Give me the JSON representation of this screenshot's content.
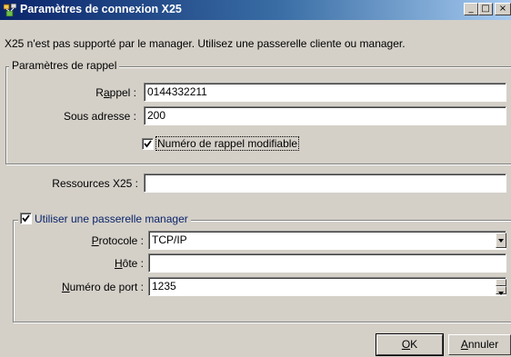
{
  "window": {
    "title": "Paramètres de connexion X25",
    "minimize_glyph": "_",
    "maximize_glyph": "□",
    "close_glyph": "×"
  },
  "info_text": "X25 n'est pas supporté par le manager. Utilisez une passerelle cliente ou manager.",
  "callback_group": {
    "legend": "Paramètres de rappel",
    "rappel_label_pre": "R",
    "rappel_label_u": "a",
    "rappel_label_post": "ppel :",
    "rappel_value": "0144332211",
    "sous_adresse_label": "Sous adresse :",
    "sous_adresse_value": "200",
    "modifiable_checked": true,
    "modifiable_label": "Numéro de rappel modifiable"
  },
  "ressources": {
    "label": "Ressources X25 :",
    "value": ""
  },
  "gateway_group": {
    "checked": true,
    "legend": "Utiliser une passerelle manager",
    "protocole_label_u": "P",
    "protocole_label_rest": "rotocole :",
    "protocole_value": "TCP/IP",
    "hote_label_u": "H",
    "hote_label_rest": "ôte :",
    "hote_value": "",
    "port_label_u": "N",
    "port_label_rest": "uméro de port :",
    "port_value": "1235"
  },
  "buttons": {
    "ok_u": "O",
    "ok_rest": "K",
    "annuler_u": "A",
    "annuler_rest": "nnuler"
  },
  "colors": {
    "title_bar_start": "#0a246a",
    "title_bar_end": "#a6caf0",
    "dialog_face": "#d4d0c8",
    "legend_link_blue": "#0a246a"
  },
  "icons": [
    "network-app-icon",
    "check-icon",
    "dropdown-arrow-icon",
    "spin-up-icon",
    "spin-down-icon"
  ]
}
